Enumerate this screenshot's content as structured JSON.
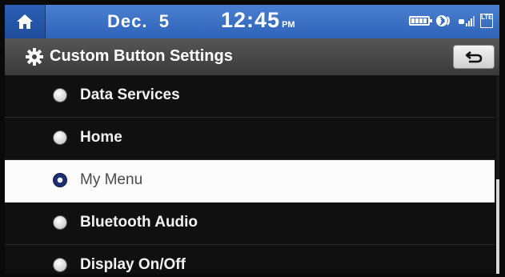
{
  "status_bar": {
    "date": "Dec.  5",
    "time": "12:45",
    "ampm": "PM",
    "network": "LTE",
    "icons": [
      "home-icon",
      "battery-icon",
      "bluetooth-audio-icon",
      "signal-icon",
      "lte-icon"
    ]
  },
  "header": {
    "title": "Custom Button Settings",
    "icon": "gear-icon",
    "back_icon": "back-arrow-icon"
  },
  "options": [
    {
      "label": "Data Services",
      "selected": false
    },
    {
      "label": "Home",
      "selected": false
    },
    {
      "label": "My Menu",
      "selected": true
    },
    {
      "label": "Bluetooth Audio",
      "selected": false
    },
    {
      "label": "Display On/Off",
      "selected": false
    }
  ],
  "colors": {
    "status_bar_blue": "#3b6fc4",
    "selected_radio": "#1c2f72",
    "selected_row_bg": "#fcfcfc"
  }
}
